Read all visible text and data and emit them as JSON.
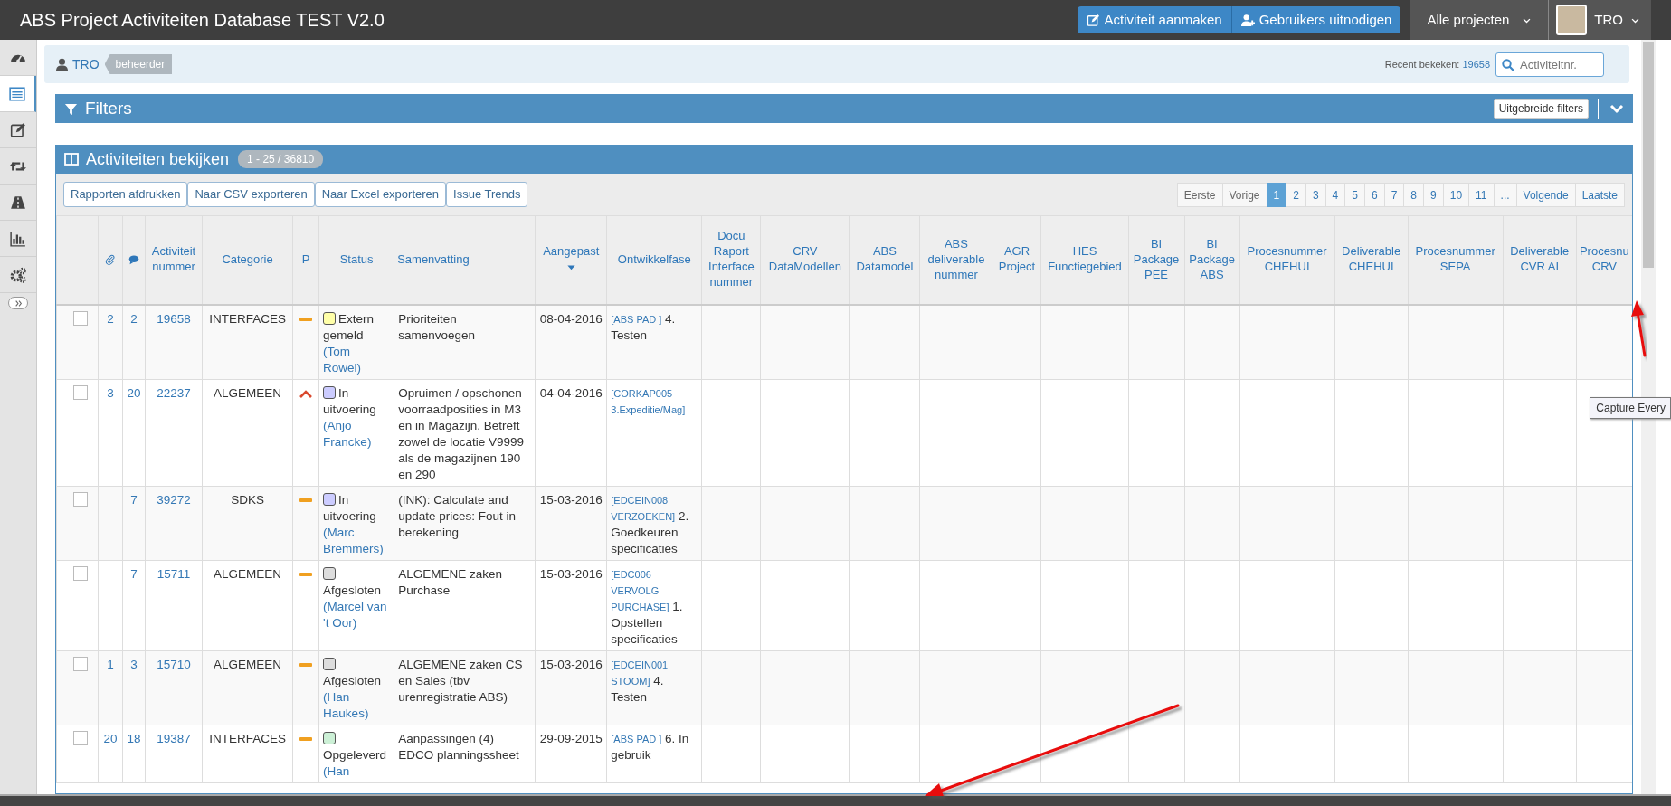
{
  "app_title": "ABS Project Activiteiten Database TEST V2.0",
  "top_actions": [
    {
      "label": "Activiteit aanmaken"
    },
    {
      "label": "Gebruikers uitnodigen"
    }
  ],
  "project_menu": {
    "label": "Alle projecten"
  },
  "user_menu": {
    "label": "TRO"
  },
  "sidebar": [
    {
      "selected": false
    },
    {
      "selected": true
    },
    {
      "selected": false
    },
    {
      "selected": false
    },
    {
      "selected": false
    },
    {
      "selected": false
    },
    {
      "selected": false
    }
  ],
  "info_bar": {
    "user": "TRO",
    "role": "beheerder",
    "recent_label": "Recent bekeken:",
    "recent_value": "19658",
    "search_placeholder": "Activiteitnr."
  },
  "filters": {
    "title": "Filters",
    "advanced_button": "Uitgebreide filters"
  },
  "panel": {
    "title": "Activiteiten bekijken",
    "count": "1 - 25 / 36810"
  },
  "toolbar": [
    "Rapporten afdrukken",
    "Naar CSV exporteren",
    "Naar Excel exporteren",
    "Issue Trends"
  ],
  "pagination": [
    {
      "label": "Eerste",
      "selected": false
    },
    {
      "label": "Vorige",
      "selected": false
    },
    {
      "label": "1",
      "selected": true
    },
    {
      "label": "2",
      "selected": false
    },
    {
      "label": "3",
      "selected": false
    },
    {
      "label": "4",
      "selected": false
    },
    {
      "label": "5",
      "selected": false
    },
    {
      "label": "6",
      "selected": false
    },
    {
      "label": "7",
      "selected": false
    },
    {
      "label": "8",
      "selected": false
    },
    {
      "label": "9",
      "selected": false
    },
    {
      "label": "10",
      "selected": false
    },
    {
      "label": "11",
      "selected": false
    },
    {
      "label": "...",
      "selected": false
    },
    {
      "label": "Volgende",
      "selected": false
    },
    {
      "label": "Laatste",
      "selected": false
    }
  ],
  "columns": [
    {
      "kind": "blank"
    },
    {
      "kind": "paperclip"
    },
    {
      "kind": "comment"
    },
    {
      "kind": "text",
      "label": "Activiteit nummer",
      "sorted": false
    },
    {
      "kind": "text",
      "label": "Categorie",
      "sorted": false
    },
    {
      "kind": "text",
      "label": "P",
      "sorted": false
    },
    {
      "kind": "text",
      "label": "Status",
      "sorted": false
    },
    {
      "kind": "text",
      "label": "Samenvatting",
      "sorted": false
    },
    {
      "kind": "text",
      "label": "Aangepast",
      "sorted": true
    },
    {
      "kind": "text",
      "label": "Ontwikkelfase",
      "sorted": false
    },
    {
      "kind": "text",
      "label": "Docu Raport Interface nummer",
      "sorted": false
    },
    {
      "kind": "text",
      "label": "CRV DataModellen",
      "sorted": false
    },
    {
      "kind": "text",
      "label": "ABS Datamodel",
      "sorted": false
    },
    {
      "kind": "text",
      "label": "ABS deliverable nummer",
      "sorted": false
    },
    {
      "kind": "text",
      "label": "AGR Project",
      "sorted": false
    },
    {
      "kind": "text",
      "label": "HES Functiegebied",
      "sorted": false
    },
    {
      "kind": "text",
      "label": "BI Package PEE",
      "sorted": false
    },
    {
      "kind": "text",
      "label": "BI Package ABS",
      "sorted": false
    },
    {
      "kind": "text",
      "label": "Procesnummer CHEHUI",
      "sorted": false
    },
    {
      "kind": "text",
      "label": "Deliverable CHEHUI",
      "sorted": false
    },
    {
      "kind": "text",
      "label": "Procesnummer SEPA",
      "sorted": false
    },
    {
      "kind": "text",
      "label": "Deliverable CVR AI",
      "sorted": false
    },
    {
      "kind": "text",
      "label": "Procesnu CRV",
      "sorted": false
    }
  ],
  "rows": [
    {
      "checked": false,
      "attachments": "2",
      "comments": "2",
      "number": "19658",
      "category": "INTERFACES",
      "priority": {
        "kind": "medium"
      },
      "status": "Extern gemeld",
      "color": "#ffffa8",
      "owner": "(Tom Rowel)",
      "summary": "Prioriteiten samenvoegen",
      "date": "08-04-2016",
      "phase_code": "[ABS PAD ]",
      "phase_step": "4. Testen"
    },
    {
      "checked": false,
      "attachments": "3",
      "comments": "20",
      "number": "22237",
      "category": "ALGEMEEN",
      "priority": {
        "kind": "high"
      },
      "status": "In uitvoering",
      "color": "#ccccff",
      "owner": "(Anjo Francke)",
      "summary": "Opruimen / opschonen voorraadposities in M3 en in Magazijn. Betreft zowel de locatie V9999 als de magazijnen 190 en 290",
      "date": "04-04-2016",
      "phase_code": "[CORKAP005 3.Expeditie/Mag]"
    },
    {
      "checked": false,
      "comments": "7",
      "number": "39272",
      "category": "SDKS",
      "priority": {
        "kind": "medium"
      },
      "status": "In uitvoering",
      "color": "#ccccff",
      "owner": "(Marc Bremmers)",
      "summary": "(INK): Calculate and update prices: Fout in berekening",
      "date": "15-03-2016",
      "phase_code": "[EDCEIN008 VERZOEKEN]",
      "phase_step": "2. Goedkeuren specificaties"
    },
    {
      "checked": false,
      "comments": "7",
      "number": "15711",
      "category": "ALGEMEEN",
      "priority": {
        "kind": "medium"
      },
      "status": "Afgesloten",
      "color": "#dddddd",
      "owner": "(Marcel van 't Oor)",
      "summary": "ALGEMENE zaken Purchase",
      "date": "15-03-2016",
      "phase_code": "[EDC006 VERVOLG PURCHASE]",
      "phase_step": "1. Opstellen specificaties"
    },
    {
      "checked": false,
      "attachments": "1",
      "comments": "3",
      "number": "15710",
      "category": "ALGEMEEN",
      "priority": {
        "kind": "medium"
      },
      "status": "Afgesloten",
      "color": "#dddddd",
      "owner": "(Han Haukes)",
      "summary": "ALGEMENE zaken CS en Sales (tbv urenregistratie ABS)",
      "date": "15-03-2016",
      "phase_code": "[EDCEIN001 STOOM]",
      "phase_step": "4. Testen"
    },
    {
      "checked": false,
      "attachments": "20",
      "comments": "18",
      "number": "19387",
      "category": "INTERFACES",
      "priority": {
        "kind": "medium"
      },
      "status": "Opgeleverd",
      "color": "#ccf0d6",
      "owner": "(Han",
      "summary": "Aanpassingen (4) EDCO planningssheet",
      "date": "29-09-2015",
      "phase_code": "[ABS PAD ]",
      "phase_step": "6. In gebruik"
    }
  ],
  "tooltip": "Capture Every"
}
